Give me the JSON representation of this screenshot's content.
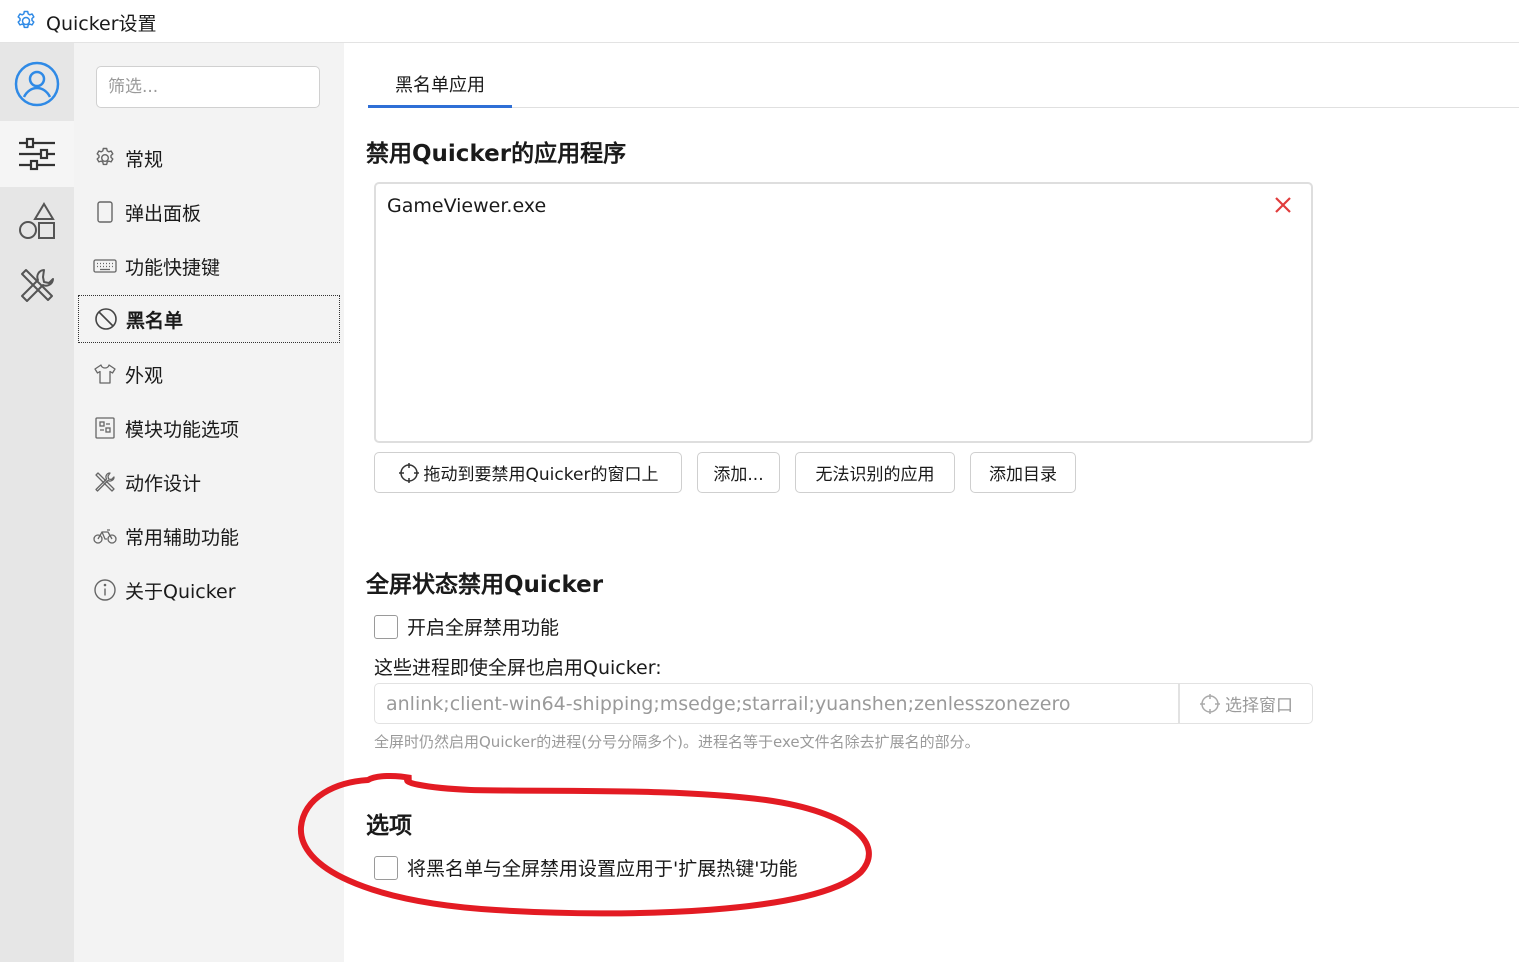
{
  "window": {
    "title": "Quicker设置"
  },
  "rail": {
    "items": [
      {
        "name": "user-icon"
      },
      {
        "name": "sliders-icon"
      },
      {
        "name": "shapes-icon"
      },
      {
        "name": "tools-icon"
      }
    ]
  },
  "nav": {
    "filter_placeholder": "筛选...",
    "items": [
      {
        "label": "常规",
        "icon": "gear-icon"
      },
      {
        "label": "弹出面板",
        "icon": "panel-icon"
      },
      {
        "label": "功能快捷键",
        "icon": "keyboard-icon"
      },
      {
        "label": "黑名单",
        "icon": "ban-icon"
      },
      {
        "label": "外观",
        "icon": "tshirt-icon"
      },
      {
        "label": "模块功能选项",
        "icon": "module-icon"
      },
      {
        "label": "动作设计",
        "icon": "design-icon"
      },
      {
        "label": "常用辅助功能",
        "icon": "bicycle-icon"
      },
      {
        "label": "关于Quicker",
        "icon": "info-icon"
      }
    ],
    "selected": "黑名单"
  },
  "main": {
    "tab": "黑名单应用",
    "blocked_apps": {
      "title": "禁用Quicker的应用程序",
      "items": [
        "GameViewer.exe"
      ],
      "buttons": {
        "drag": "拖动到要禁用Quicker的窗口上",
        "add": "添加...",
        "unknown": "无法识别的应用",
        "add_dir": "添加目录"
      }
    },
    "fullscreen": {
      "title": "全屏状态禁用Quicker",
      "enable_label": "开启全屏禁用功能",
      "enable_checked": false,
      "exceptions_label": "这些进程即使全屏也启用Quicker:",
      "exceptions_value": "anlink;client-win64-shipping;msedge;starrail;yuanshen;zenlesszonezero",
      "pick_button": "选择窗口",
      "hint": "全屏时仍然启用Quicker的进程(分号分隔多个)。进程名等于exe文件名除去扩展名的部分。"
    },
    "options": {
      "title": "选项",
      "apply_label": "将黑名单与全屏禁用设置应用于'扩展热键'功能",
      "apply_checked": false
    }
  },
  "colors": {
    "accent": "#2f6fd6",
    "remove": "#e03c3c",
    "annotation": "#e31b23"
  }
}
